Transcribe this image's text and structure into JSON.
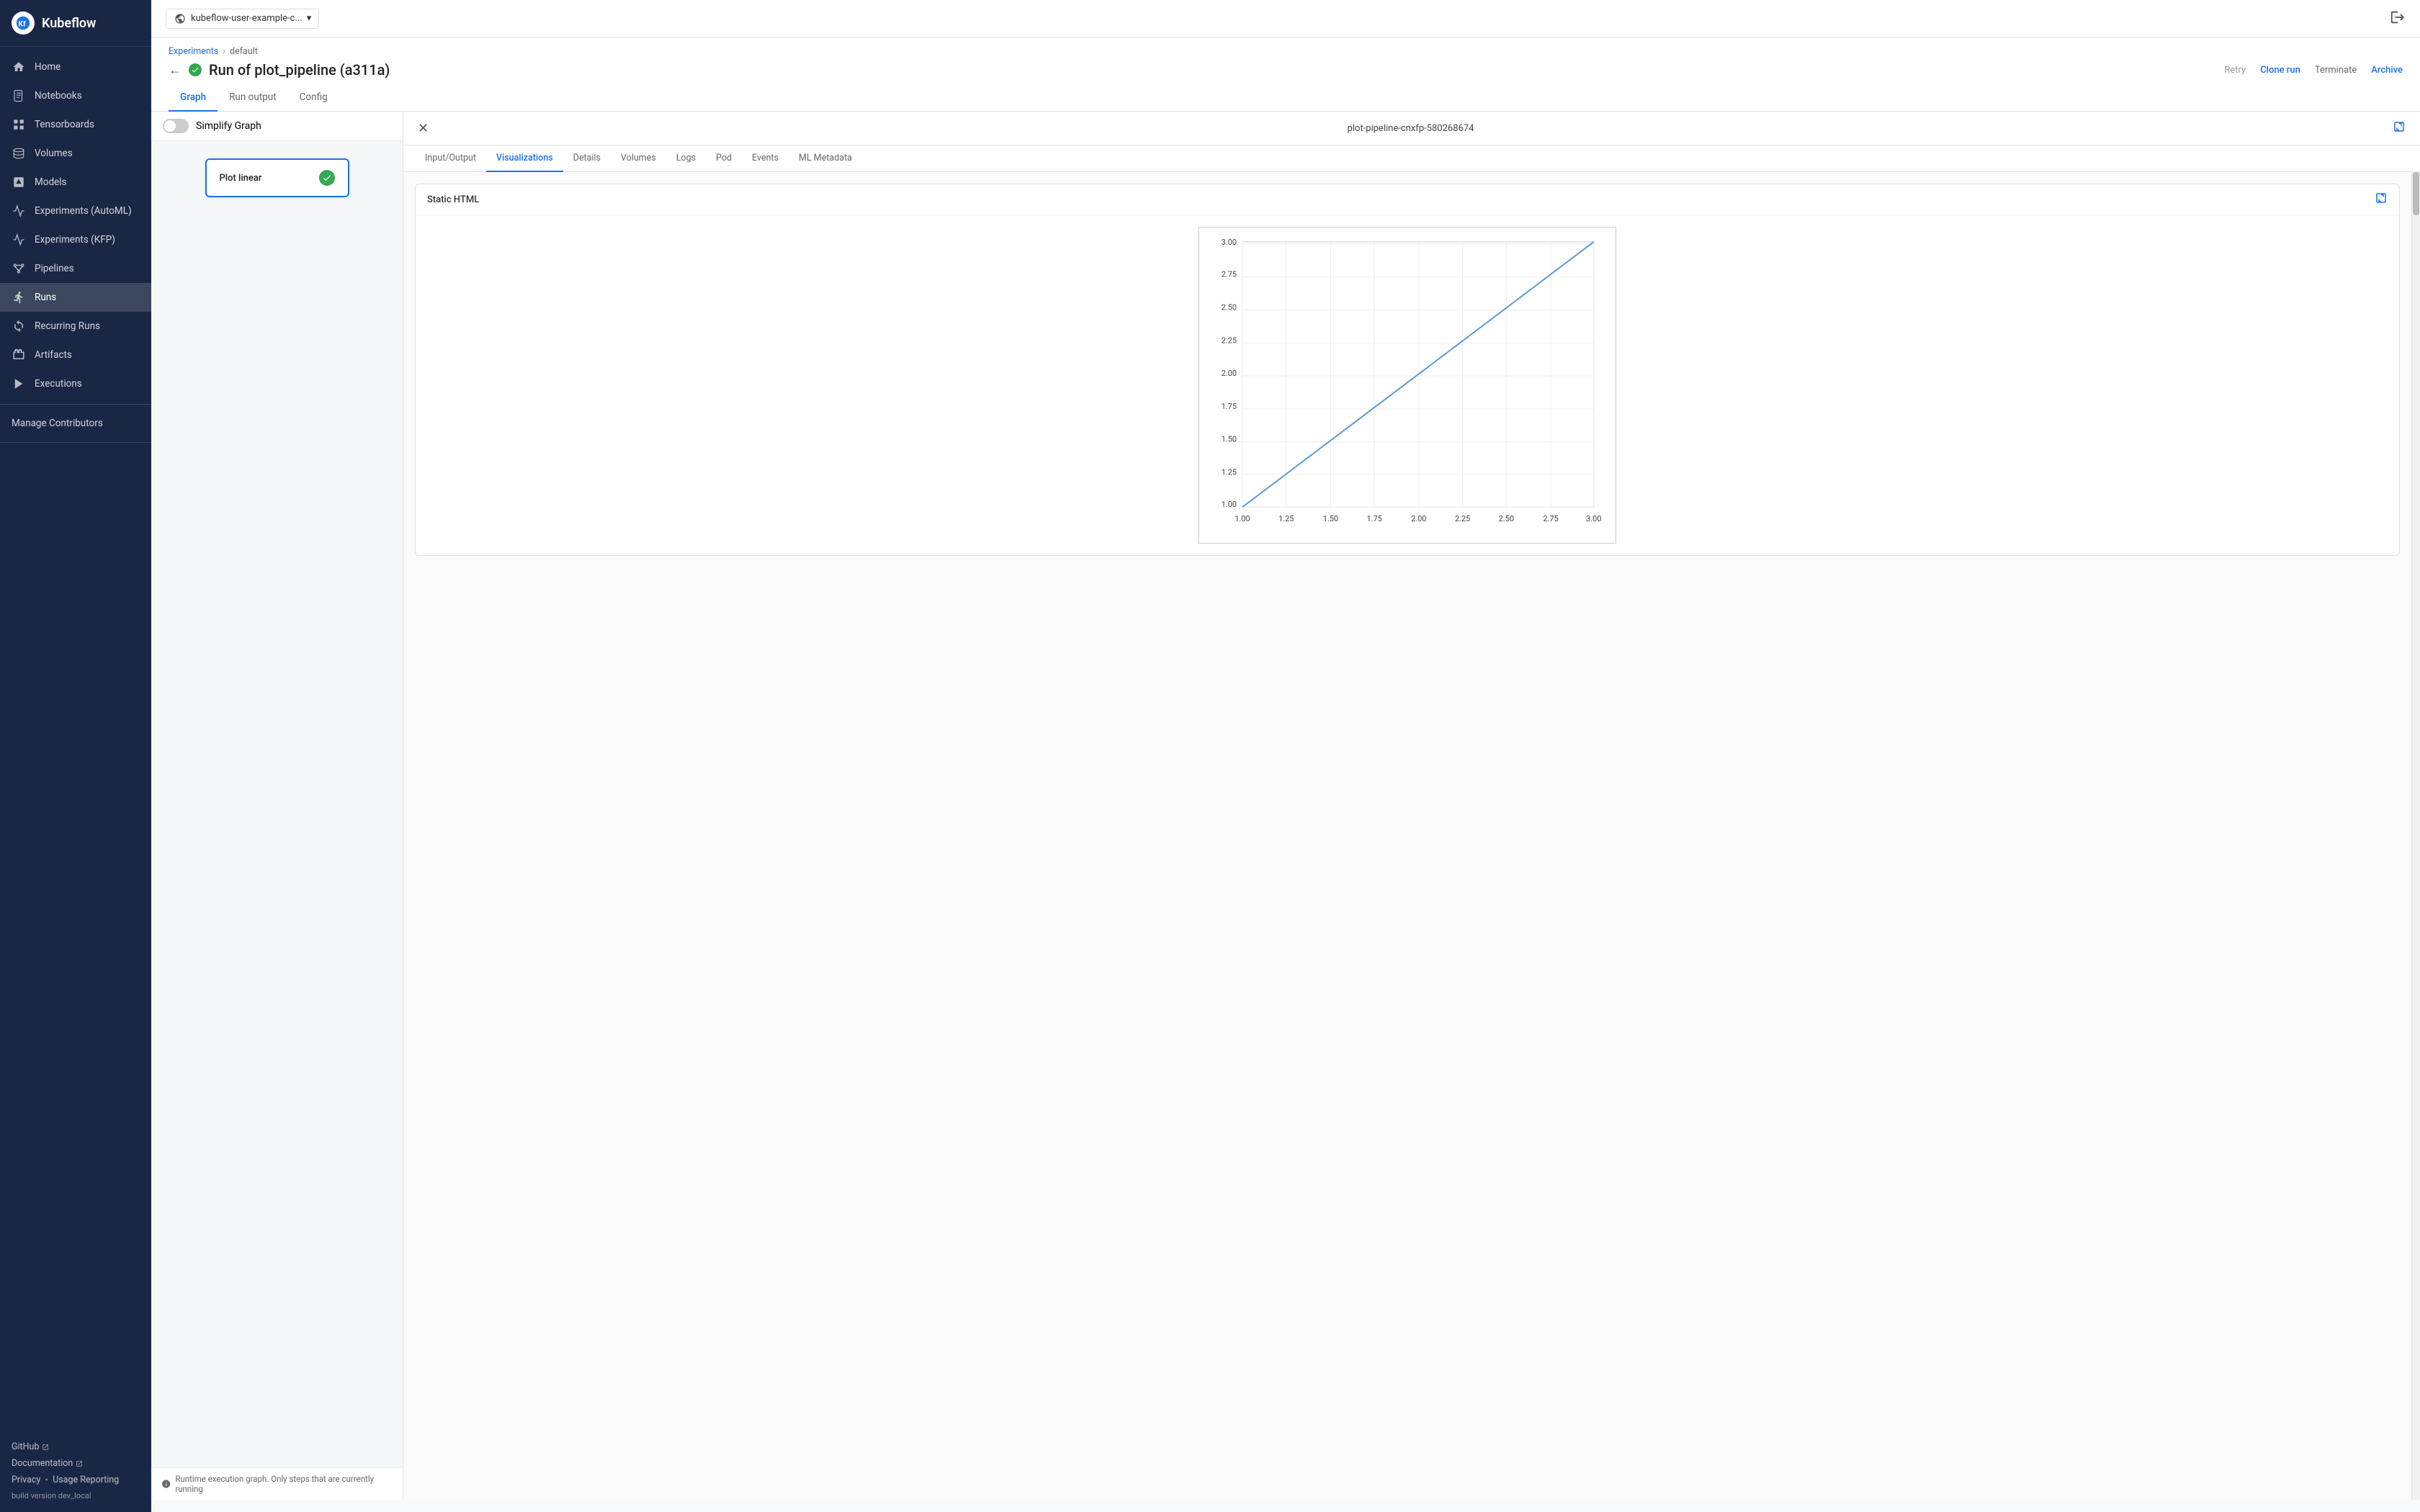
{
  "app": {
    "name": "Kubeflow"
  },
  "topbar": {
    "namespace": "kubeflow-user-example-c...",
    "dropdown_icon": "▾"
  },
  "sidebar": {
    "items": [
      {
        "id": "home",
        "label": "Home",
        "icon": "home"
      },
      {
        "id": "notebooks",
        "label": "Notebooks",
        "icon": "notebook"
      },
      {
        "id": "tensorboards",
        "label": "Tensorboards",
        "icon": "tensorboard"
      },
      {
        "id": "volumes",
        "label": "Volumes",
        "icon": "volume"
      },
      {
        "id": "models",
        "label": "Models",
        "icon": "models"
      },
      {
        "id": "experiments-automl",
        "label": "Experiments (AutoML)",
        "icon": "experiments"
      },
      {
        "id": "experiments-kfp",
        "label": "Experiments (KFP)",
        "icon": "experiments2"
      },
      {
        "id": "pipelines",
        "label": "Pipelines",
        "icon": "pipeline"
      },
      {
        "id": "runs",
        "label": "Runs",
        "icon": "runs",
        "active": true
      },
      {
        "id": "recurring-runs",
        "label": "Recurring Runs",
        "icon": "recurring"
      },
      {
        "id": "artifacts",
        "label": "Artifacts",
        "icon": "artifacts"
      },
      {
        "id": "executions",
        "label": "Executions",
        "icon": "executions"
      }
    ],
    "manage_contributors": "Manage Contributors",
    "github_label": "GitHub",
    "docs_label": "Documentation",
    "privacy_label": "Privacy",
    "usage_label": "Usage Reporting",
    "build_label": "build version dev_local"
  },
  "breadcrumb": {
    "experiments": "Experiments",
    "separator": "›",
    "current": "default"
  },
  "page": {
    "title": "Run of plot_pipeline (a311a)",
    "actions": {
      "retry": "Retry",
      "clone": "Clone run",
      "terminate": "Terminate",
      "archive": "Archive"
    }
  },
  "tabs": {
    "graph": "Graph",
    "run_output": "Run output",
    "config": "Config"
  },
  "graph_panel": {
    "simplify_graph": "Simplify Graph",
    "node_label": "Plot linear",
    "footer_text": "Runtime execution graph. Only steps that are currently running"
  },
  "detail_panel": {
    "title": "plot-pipeline-cnxfp-580268674",
    "tabs": [
      "Input/Output",
      "Visualizations",
      "Details",
      "Volumes",
      "Logs",
      "Pod",
      "Events",
      "ML Metadata"
    ],
    "active_tab": "Visualizations",
    "viz_card": {
      "header": "Static HTML"
    }
  },
  "chart": {
    "x_labels": [
      "1.00",
      "1.25",
      "1.50",
      "1.75",
      "2.00",
      "2.25",
      "2.50",
      "2.75",
      "3.00"
    ],
    "y_labels": [
      "1.00",
      "1.25",
      "1.50",
      "1.75",
      "2.00",
      "2.25",
      "2.50",
      "2.75",
      "3.00"
    ],
    "line_color": "#5b9bd5",
    "x1": 1.0,
    "y1": 1.0,
    "x2": 3.0,
    "y2": 3.0
  }
}
